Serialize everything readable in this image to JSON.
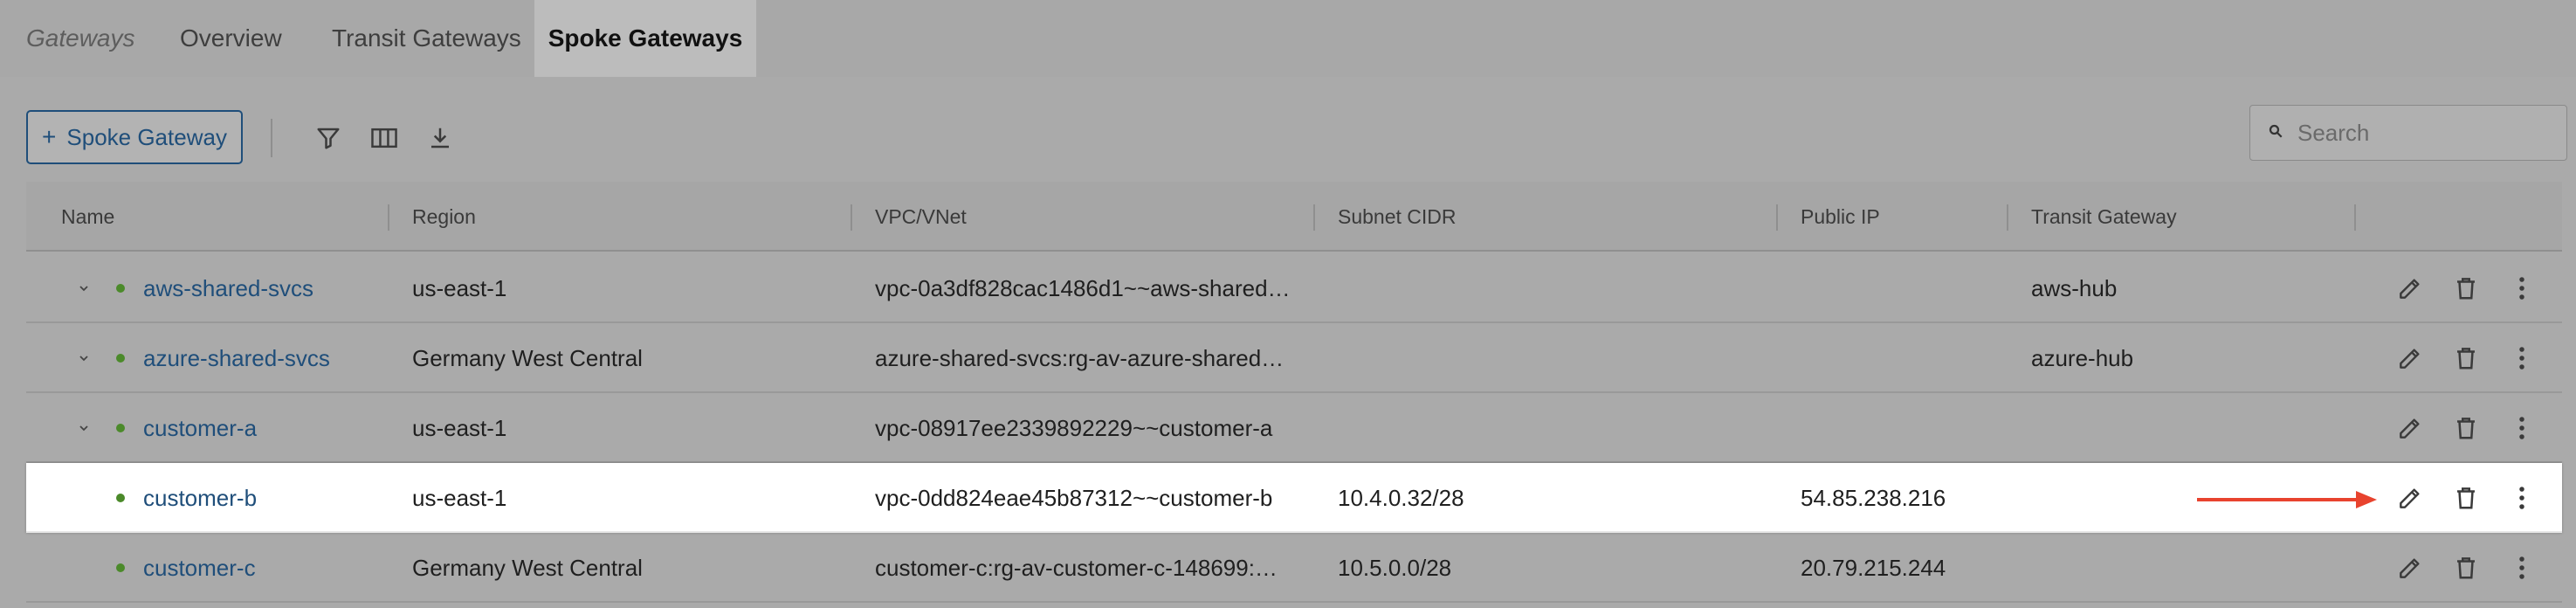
{
  "tabs": {
    "breadcrumb": "Gateways",
    "overview": "Overview",
    "transit": "Transit Gateways",
    "spoke": "Spoke Gateways"
  },
  "toolbar": {
    "add_label": "Spoke Gateway",
    "search_placeholder": "Search"
  },
  "table": {
    "headers": {
      "name": "Name",
      "region": "Region",
      "vpc": "VPC/VNet",
      "subnet": "Subnet CIDR",
      "public_ip": "Public IP",
      "transit": "Transit Gateway"
    },
    "rows": [
      {
        "name": "aws-shared-svcs",
        "region": "us-east-1",
        "vpc": "vpc-0a3df828cac1486d1~~aws-shared…",
        "subnet": "",
        "public_ip": "",
        "transit": "aws-hub",
        "expandable": true,
        "status": "up"
      },
      {
        "name": "azure-shared-svcs",
        "region": "Germany West Central",
        "vpc": "azure-shared-svcs:rg-av-azure-shared…",
        "subnet": "",
        "public_ip": "",
        "transit": "azure-hub",
        "expandable": true,
        "status": "up"
      },
      {
        "name": "customer-a",
        "region": "us-east-1",
        "vpc": "vpc-08917ee2339892229~~customer-a",
        "subnet": "",
        "public_ip": "",
        "transit": "",
        "expandable": true,
        "status": "up"
      },
      {
        "name": "customer-b",
        "region": "us-east-1",
        "vpc": "vpc-0dd824eae45b87312~~customer-b",
        "subnet": "10.4.0.32/28",
        "public_ip": "54.85.238.216",
        "transit": "",
        "expandable": false,
        "status": "up"
      },
      {
        "name": "customer-c",
        "region": "Germany West Central",
        "vpc": "customer-c:rg-av-customer-c-148699:…",
        "subnet": "10.5.0.0/28",
        "public_ip": "20.79.215.244",
        "transit": "",
        "expandable": false,
        "status": "up"
      }
    ]
  },
  "colors": {
    "link": "#1f4e7a",
    "status_up": "#4b8a2a",
    "annotation_arrow": "#e8432e"
  },
  "icons": [
    "plus-icon",
    "filter-icon",
    "columns-icon",
    "download-icon",
    "search-icon",
    "chevron-down-icon",
    "edit-icon",
    "delete-icon",
    "more-icon",
    "arrow-icon"
  ]
}
